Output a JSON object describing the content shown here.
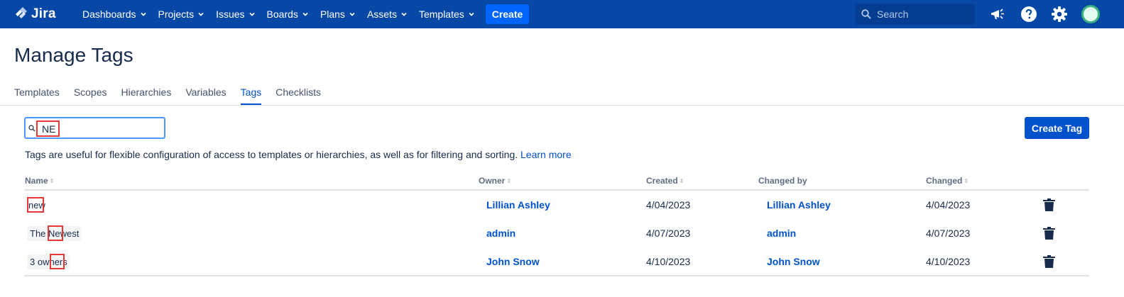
{
  "topbar": {
    "logo_text": "Jira",
    "nav": [
      {
        "label": "Dashboards"
      },
      {
        "label": "Projects"
      },
      {
        "label": "Issues"
      },
      {
        "label": "Boards"
      },
      {
        "label": "Plans"
      },
      {
        "label": "Assets"
      },
      {
        "label": "Templates"
      }
    ],
    "create_label": "Create",
    "search_placeholder": "Search",
    "icons": [
      "megaphone-icon",
      "help-icon",
      "settings-gear-icon",
      "user-avatar"
    ]
  },
  "page": {
    "title": "Manage Tags",
    "tabs": [
      {
        "label": "Templates",
        "active": false
      },
      {
        "label": "Scopes",
        "active": false
      },
      {
        "label": "Hierarchies",
        "active": false
      },
      {
        "label": "Variables",
        "active": false
      },
      {
        "label": "Tags",
        "active": true
      },
      {
        "label": "Checklists",
        "active": false
      }
    ]
  },
  "filter": {
    "value": "NE"
  },
  "create_tag_label": "Create Tag",
  "description": {
    "text": "Tags are useful for flexible configuration of access to templates or hierarchies, as well as for filtering and sorting.",
    "link": "Learn more"
  },
  "table": {
    "headers": {
      "name": "Name",
      "owner": "Owner",
      "created": "Created",
      "changed_by": "Changed by",
      "changed": "Changed"
    },
    "rows": [
      {
        "name": "new",
        "owner": "Lillian Ashley",
        "created": "4/04/2023",
        "changed_by": "Lillian Ashley",
        "changed": "4/04/2023"
      },
      {
        "name": "The Newest",
        "owner": "admin",
        "created": "4/07/2023",
        "changed_by": "admin",
        "changed": "4/07/2023"
      },
      {
        "name": "3 owners",
        "owner": "John Snow",
        "created": "4/10/2023",
        "changed_by": "John Snow",
        "changed": "4/10/2023"
      }
    ]
  },
  "colors": {
    "topbar": "#0747a6",
    "accent": "#0052cc",
    "highlight": "#e53935"
  }
}
